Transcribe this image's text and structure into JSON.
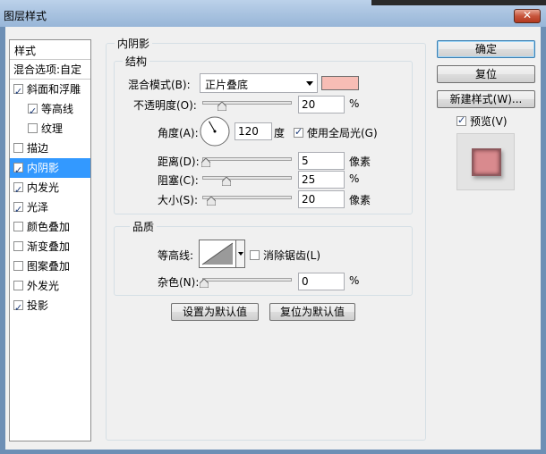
{
  "window": {
    "title": "图层样式",
    "close_symbol": "✕"
  },
  "sidebar": {
    "header": "样式",
    "blend_item": "混合选项:自定",
    "items": [
      {
        "label": "斜面和浮雕",
        "checked": true,
        "indent": false,
        "selected": false
      },
      {
        "label": "等高线",
        "checked": true,
        "indent": true,
        "selected": false
      },
      {
        "label": "纹理",
        "checked": false,
        "indent": true,
        "selected": false
      },
      {
        "label": "描边",
        "checked": false,
        "indent": false,
        "selected": false
      },
      {
        "label": "内阴影",
        "checked": true,
        "indent": false,
        "selected": true
      },
      {
        "label": "内发光",
        "checked": true,
        "indent": false,
        "selected": false
      },
      {
        "label": "光泽",
        "checked": true,
        "indent": false,
        "selected": false
      },
      {
        "label": "颜色叠加",
        "checked": false,
        "indent": false,
        "selected": false
      },
      {
        "label": "渐变叠加",
        "checked": false,
        "indent": false,
        "selected": false
      },
      {
        "label": "图案叠加",
        "checked": false,
        "indent": false,
        "selected": false
      },
      {
        "label": "外发光",
        "checked": false,
        "indent": false,
        "selected": false
      },
      {
        "label": "投影",
        "checked": true,
        "indent": false,
        "selected": false
      }
    ]
  },
  "panel": {
    "title": "内阴影",
    "structure": {
      "title": "结构",
      "blend_mode_label": "混合模式(B):",
      "blend_mode_value": "正片叠底",
      "color": "#f7bdb5",
      "opacity_label": "不透明度(O):",
      "opacity_value": "20",
      "opacity_unit": "%",
      "angle_label": "角度(A):",
      "angle_value": "120",
      "angle_unit": "度",
      "global_light_label": "使用全局光(G)",
      "global_light_checked": true,
      "distance_label": "距离(D):",
      "distance_value": "5",
      "distance_unit": "像素",
      "choke_label": "阻塞(C):",
      "choke_value": "25",
      "choke_unit": "%",
      "size_label": "大小(S):",
      "size_value": "20",
      "size_unit": "像素"
    },
    "quality": {
      "title": "品质",
      "contour_label": "等高线:",
      "antialias_label": "消除锯齿(L)",
      "antialias_checked": false,
      "noise_label": "杂色(N):",
      "noise_value": "0",
      "noise_unit": "%"
    },
    "set_default_button": "设置为默认值",
    "reset_default_button": "复位为默认值"
  },
  "actions": {
    "ok_button": "确定",
    "reset_button": "复位",
    "new_style_button": "新建样式(W)...",
    "preview_label": "预览(V)",
    "preview_checked": true
  },
  "colors": {
    "selection": "#3399ff",
    "preview_fill": "#d98a8e"
  }
}
